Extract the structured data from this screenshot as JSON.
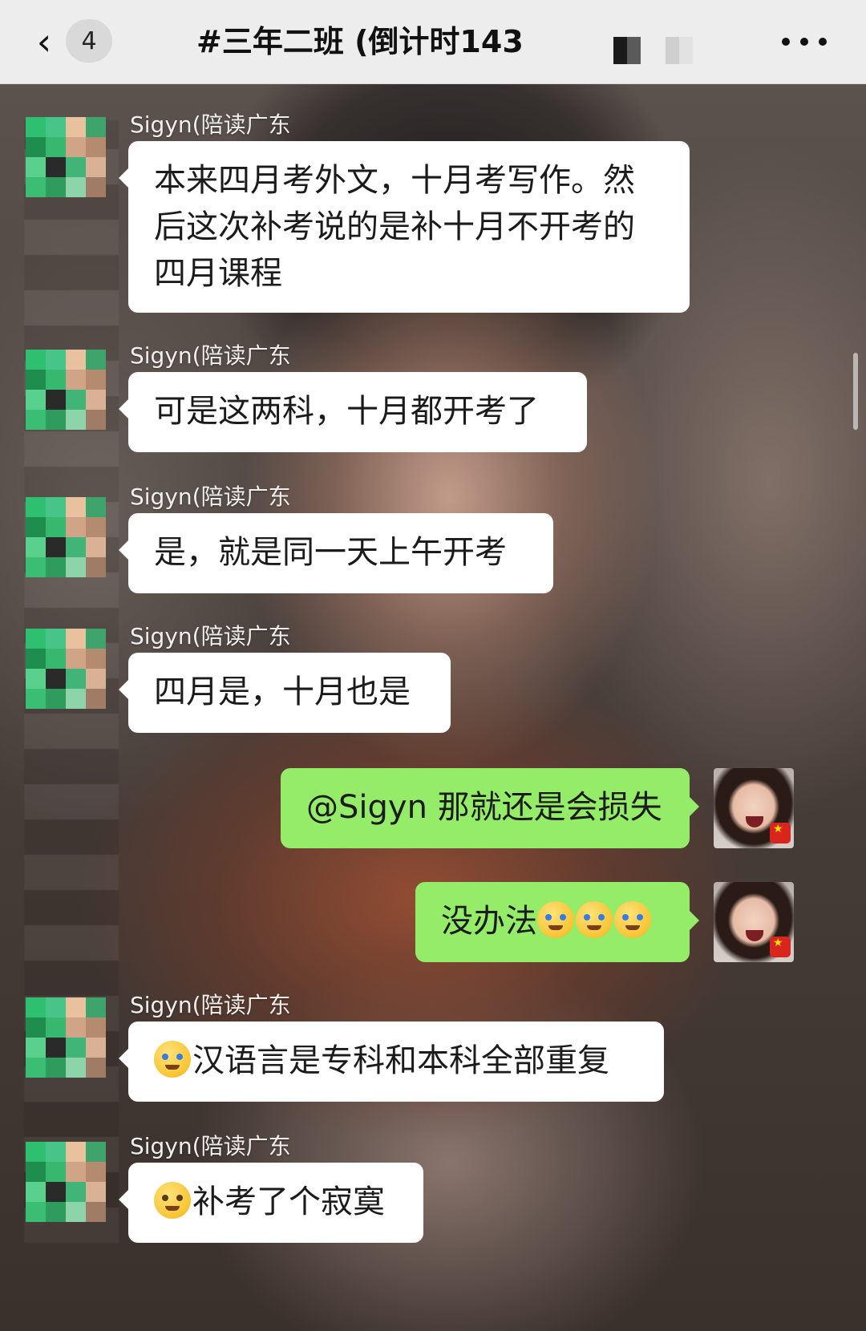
{
  "header": {
    "back_icon": "chevron-left-icon",
    "unread_count": "4",
    "title": "#三年二班 (倒计时143",
    "more_icon": "more-dots-icon"
  },
  "messages": [
    {
      "side": "left",
      "sender": "Sigyn(陪读广东",
      "lines": [
        "本来四月考外文，十月考写作。然",
        "后这次补考说的是补十月不开考的",
        "四月课程"
      ]
    },
    {
      "side": "left",
      "sender": "Sigyn(陪读广东",
      "text": "可是这两科，十月都开考了"
    },
    {
      "side": "left",
      "sender": "Sigyn(陪读广东",
      "text": "是，就是同一天上午开考"
    },
    {
      "side": "left",
      "sender": "Sigyn(陪读广东",
      "text": "四月是，十月也是"
    },
    {
      "side": "right",
      "text": "@Sigyn 那就还是会损失"
    },
    {
      "side": "right",
      "text": "没办法"
    },
    {
      "side": "left",
      "sender": "Sigyn(陪读广东",
      "text": "汉语言是专科和本科全部重复"
    },
    {
      "side": "left",
      "sender": "Sigyn(陪读广东",
      "text": "补考了个寂寞"
    }
  ],
  "colors": {
    "my_bubble": "#95ec69",
    "other_bubble": "#ffffff",
    "topbar": "#ededed"
  }
}
